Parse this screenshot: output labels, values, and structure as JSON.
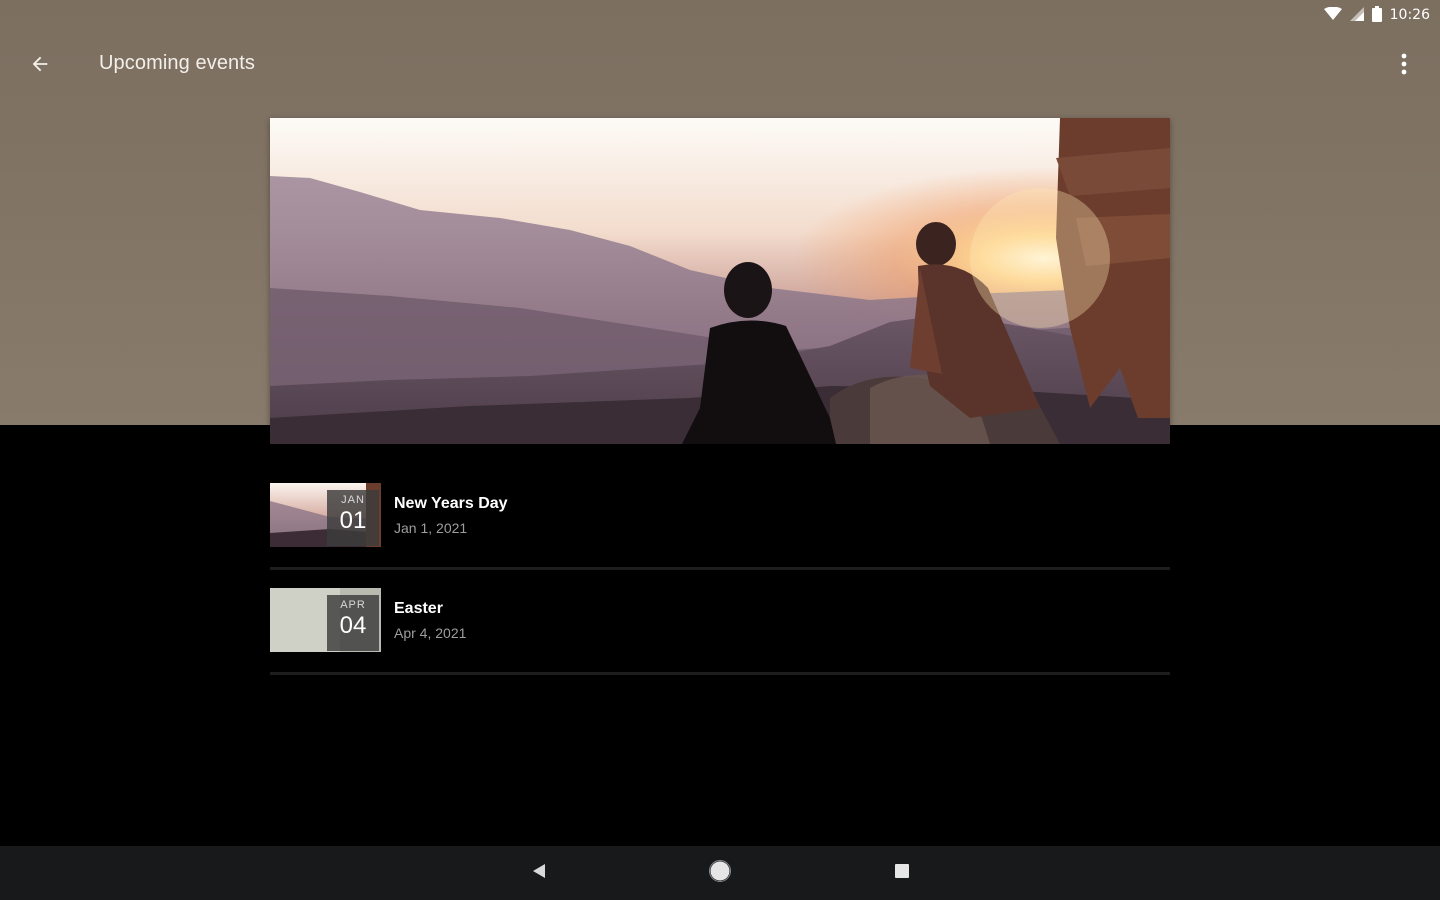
{
  "status_bar": {
    "time": "10:26",
    "icons": [
      "wifi-icon",
      "signal-icon",
      "battery-icon"
    ]
  },
  "app_bar": {
    "title": "Upcoming events",
    "back_icon": "arrow-back-icon",
    "menu_icon": "more-vert-icon"
  },
  "hero": {
    "subject": "sunset-over-mountains-photo"
  },
  "events": [
    {
      "month": "JAN",
      "day": "01",
      "title": "New Years Day",
      "date": "Jan 1, 2021",
      "thumb": "sunset-photo"
    },
    {
      "month": "APR",
      "day": "04",
      "title": "Easter",
      "date": "Apr 4, 2021",
      "thumb": "plain-photo"
    }
  ],
  "nav_bar": {
    "back": "nav-back-icon",
    "home": "nav-home-icon",
    "recents": "nav-recents-icon"
  },
  "colors": {
    "header": "#7f7263",
    "background": "#000000",
    "nav_bar": "#18191b",
    "divider": "#1d1d1d"
  }
}
